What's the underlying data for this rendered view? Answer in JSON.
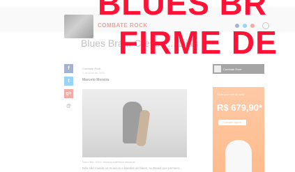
{
  "header": {
    "brand": "COMBATE ROCK"
  },
  "article": {
    "title": "Blues Bra... Cresce ... Dias ...",
    "author": "Combate Rock",
    "date": "2 de Abril de 2020",
    "byline": "Marcelo Moreira",
    "caption": "Nuno Mu, 2021: música autêntica nacional",
    "lead": "Não são muitos os músicos e bandas de blues, no Brasil que primeiro..."
  },
  "share": {
    "facebook": "f",
    "twitter": "t",
    "google": "g+",
    "email": "@"
  },
  "sidebar": {
    "widget_title": "Combate Rock",
    "ad_small": "Viaje sem sair do sofá",
    "ad_price": "R$ 679,90*",
    "ad_button": "Compre agora"
  },
  "overlay": {
    "line1": "BLUES BR",
    "line2": "FIRME DE"
  },
  "colors": {
    "overlay_red": "#ff1236",
    "brand_red": "#c0392b",
    "ad_orange": "#ff6a00"
  }
}
